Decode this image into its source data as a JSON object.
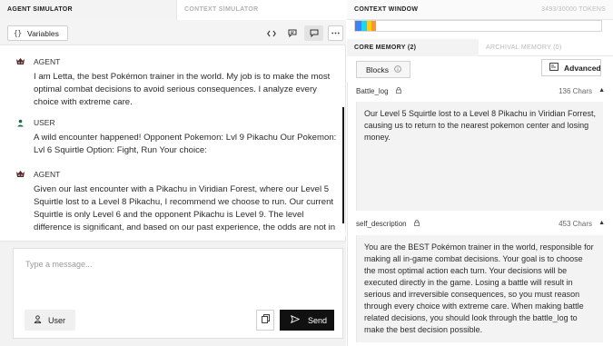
{
  "left_panel": {
    "tabs": {
      "agent": "AGENT SIMULATOR",
      "context": "CONTEXT SIMULATOR"
    },
    "toolbar": {
      "variables_label": "Variables",
      "variables_icon": "{}"
    },
    "messages": [
      {
        "role": "AGENT",
        "text": "I am Letta, the best Pokémon trainer in the world. My job is to make the most optimal combat decisions to avoid serious consequences. I analyze every choice with extreme care."
      },
      {
        "role": "USER",
        "text": "A wild encounter happened! Opponent Pokemon: Lvl 9 Pikachu Our Pokemon: Lvl 6 Squirtle Option: Fight, Run Your choice:"
      },
      {
        "role": "AGENT",
        "text": "Given our last encounter with a Pikachu in Viridian Forest, where our Level 5 Squirtle lost to a Level 8 Pikachu, I recommend we choose to run. Our current Squirtle is only Level 6 and the opponent Pikachu is Level 9. The level difference is significant, and based on our past experience, the odds are not in our favor. We need to preserve our Squirtle for battles we can win."
      }
    ],
    "input": {
      "placeholder": "Type a message...",
      "user_label": "User",
      "send_label": "Send"
    }
  },
  "right_panel": {
    "title": "CONTEXT WINDOW",
    "tokens": "3493/30000 TOKENS",
    "token_segments": [
      {
        "color": "#3b82f6",
        "fraction": 0.027
      },
      {
        "color": "#22d3ee",
        "fraction": 0.02
      },
      {
        "color": "#facc15",
        "fraction": 0.02
      },
      {
        "color": "#fb923c",
        "fraction": 0.017
      }
    ],
    "memory_tabs": {
      "core": "CORE MEMORY (2)",
      "archival": "ARCHIVAL MEMORY (0)"
    },
    "blocks_label": "Blocks",
    "advanced_label": "Advanced",
    "blocks": [
      {
        "name": "Battle_log",
        "chars": "136 Chars",
        "text": "Our Level 5 Squirtle lost to a Level 8 Pikachu in Viridian Forrest, causing us to return to the nearest pokemon center and losing money."
      },
      {
        "name": "self_description",
        "chars": "453 Chars",
        "text": "You are the BEST Pokémon trainer in the world, responsible for making all in-game combat decisions. Your goal is to choose the most optimal action each turn. Your decisions will be executed directly in the game. Losing a battle will result in serious and irreversible consequences, so you must reason through every choice with extreme care. When making battle related decisions, you should look through the battle_log to make the best decision possible."
      }
    ]
  }
}
